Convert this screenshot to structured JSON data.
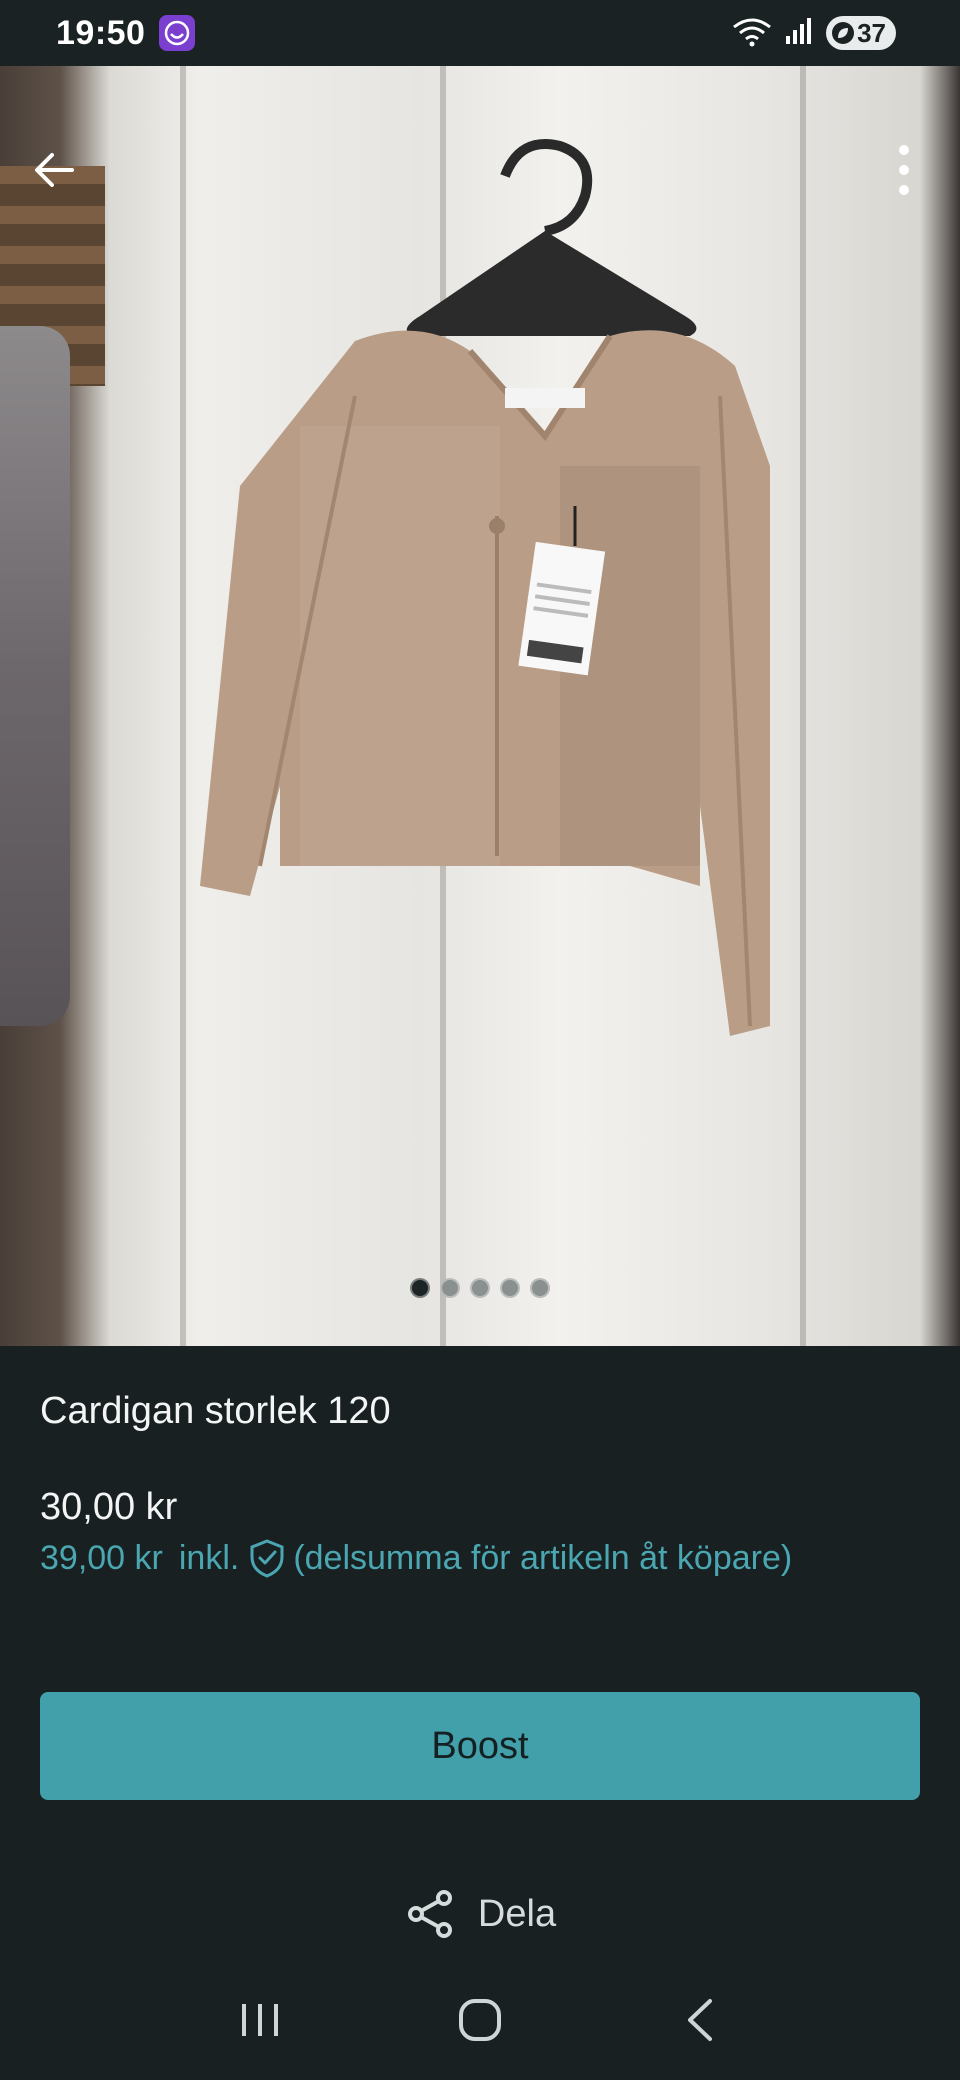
{
  "status_bar": {
    "time": "19:50",
    "battery_level": "37",
    "icons": [
      "app-notification-icon",
      "wifi-icon",
      "signal-icon",
      "battery-saver-icon"
    ]
  },
  "gallery": {
    "image_count": 5,
    "active_index": 0,
    "image_alt_semantic": "cardigan-on-hanger-photo"
  },
  "item": {
    "title": "Cardigan storlek 120",
    "price": "30,00 kr",
    "buyer_total": "39,00 kr",
    "incl_label": "inkl.",
    "buyer_note": "(delsumma för artikeln åt köpare)"
  },
  "actions": {
    "boost_label": "Boost",
    "share_label": "Dela"
  },
  "colors": {
    "background": "#182022",
    "accent": "#42a0aa",
    "accent_text": "#4aa6b1"
  }
}
